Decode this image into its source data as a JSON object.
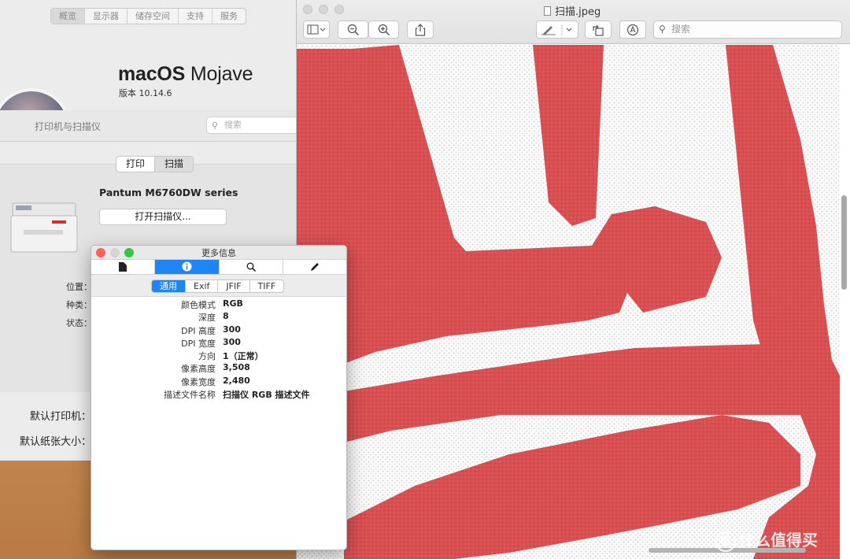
{
  "about": {
    "tabs": [
      "概览",
      "显示器",
      "储存空间",
      "支持",
      "服务"
    ],
    "os_name_bold": "macOS",
    "os_name_light": " Mojave",
    "version": "版本 10.14.6"
  },
  "printers": {
    "title": "打印机与扫描仪",
    "search_placeholder": "搜索",
    "segments": [
      "打印",
      "扫描"
    ],
    "printer_name": "Pantum M6760DW series",
    "open_scanner_label": "打开扫描仪...",
    "labels": {
      "location": "位置：",
      "kind": "种类：",
      "status": "状态："
    },
    "default_printer_label": "默认打印机：",
    "default_paper_label": "默认纸张大小："
  },
  "preview": {
    "title": "扫描.jpeg",
    "search_placeholder": "搜索",
    "watermark": "什么值得买",
    "watermark_badge": "值",
    "colors": {
      "stamp_red": "#d85050",
      "paper": "#f8f8f8"
    }
  },
  "inspector": {
    "title": "更多信息",
    "subtabs": [
      "通用",
      "Exif",
      "JFIF",
      "TIFF"
    ],
    "rows": [
      {
        "key": "颜色模式",
        "value": "RGB"
      },
      {
        "key": "深度",
        "value": "8"
      },
      {
        "key": "DPI 高度",
        "value": "300"
      },
      {
        "key": "DPI 宽度",
        "value": "300"
      },
      {
        "key": "方向",
        "value": "1（正常）"
      },
      {
        "key": "像素高度",
        "value": "3,508"
      },
      {
        "key": "像素宽度",
        "value": "2,480"
      },
      {
        "key": "描述文件名称",
        "value": "扫描仪 RGB 描述文件"
      }
    ]
  }
}
